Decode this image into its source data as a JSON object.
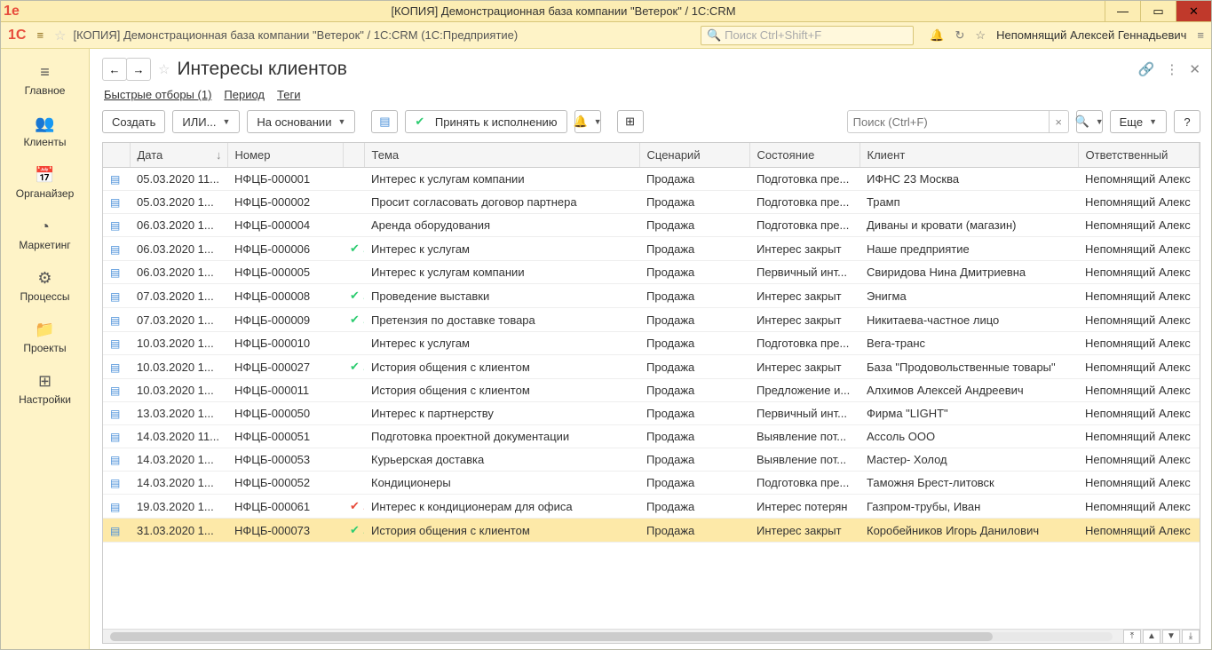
{
  "window": {
    "title": "[КОПИЯ] Демонстрационная база компании \"Ветерок\" / 1C:CRM"
  },
  "app": {
    "title": "[КОПИЯ] Демонстрационная база компании \"Ветерок\" / 1C:CRM  (1С:Предприятие)",
    "search_placeholder": "Поиск Ctrl+Shift+F",
    "user": "Непомнящий Алексей Геннадьевич"
  },
  "sidebar": {
    "items": [
      {
        "icon": "≡",
        "label": "Главное"
      },
      {
        "icon": "👥",
        "label": "Клиенты"
      },
      {
        "icon": "📅",
        "label": "Органайзер"
      },
      {
        "icon": "◔",
        "label": "Маркетинг"
      },
      {
        "icon": "⚙",
        "label": "Процессы"
      },
      {
        "icon": "📁",
        "label": "Проекты"
      },
      {
        "icon": "⊞",
        "label": "Настройки"
      }
    ]
  },
  "page": {
    "title": "Интересы клиентов"
  },
  "filters": {
    "quick": "Быстрые отборы (1)",
    "period": "Период",
    "tags": "Теги"
  },
  "toolbar": {
    "create": "Создать",
    "or": "ИЛИ...",
    "based_on": "На основании",
    "accept": "Принять к исполнению",
    "search_placeholder": "Поиск (Ctrl+F)",
    "more": "Еще",
    "help": "?"
  },
  "table": {
    "columns": {
      "date": "Дата",
      "number": "Номер",
      "theme": "Тема",
      "scenario": "Сценарий",
      "state": "Состояние",
      "client": "Клиент",
      "responsible": "Ответственный"
    },
    "rows": [
      {
        "date": "05.03.2020 11...",
        "number": "НФЦБ-000001",
        "status": "",
        "theme": "Интерес к услугам компании",
        "scenario": "Продажа",
        "state": "Подготовка пре...",
        "client": "ИФНС 23 Москва",
        "responsible": "Непомнящий Алекс"
      },
      {
        "date": "05.03.2020 1...",
        "number": "НФЦБ-000002",
        "status": "",
        "theme": "Просит согласовать договор партнера",
        "scenario": "Продажа",
        "state": "Подготовка пре...",
        "client": "Трамп",
        "responsible": "Непомнящий Алекс"
      },
      {
        "date": "06.03.2020 1...",
        "number": "НФЦБ-000004",
        "status": "",
        "theme": "Аренда оборудования",
        "scenario": "Продажа",
        "state": "Подготовка пре...",
        "client": "Диваны и кровати (магазин)",
        "responsible": "Непомнящий Алекс"
      },
      {
        "date": "06.03.2020 1...",
        "number": "НФЦБ-000006",
        "status": "ok",
        "theme": "Интерес к услугам",
        "scenario": "Продажа",
        "state": "Интерес закрыт",
        "client": "Наше предприятие",
        "responsible": "Непомнящий Алекс"
      },
      {
        "date": "06.03.2020 1...",
        "number": "НФЦБ-000005",
        "status": "",
        "theme": "Интерес к услугам компании",
        "scenario": "Продажа",
        "state": "Первичный инт...",
        "client": "Свиридова Нина Дмитриевна",
        "responsible": "Непомнящий Алекс"
      },
      {
        "date": "07.03.2020 1...",
        "number": "НФЦБ-000008",
        "status": "ok",
        "theme": "Проведение выставки",
        "scenario": "Продажа",
        "state": "Интерес закрыт",
        "client": "Энигма",
        "responsible": "Непомнящий Алекс"
      },
      {
        "date": "07.03.2020 1...",
        "number": "НФЦБ-000009",
        "status": "ok",
        "theme": "Претензия по доставке товара",
        "scenario": "Продажа",
        "state": "Интерес закрыт",
        "client": "Никитаева-частное лицо",
        "responsible": "Непомнящий Алекс"
      },
      {
        "date": "10.03.2020 1...",
        "number": "НФЦБ-000010",
        "status": "",
        "theme": "Интерес к услугам",
        "scenario": "Продажа",
        "state": "Подготовка пре...",
        "client": "Вега-транс",
        "responsible": "Непомнящий Алекс"
      },
      {
        "date": "10.03.2020 1...",
        "number": "НФЦБ-000027",
        "status": "ok",
        "theme": "История общения с клиентом",
        "scenario": "Продажа",
        "state": "Интерес закрыт",
        "client": "База \"Продовольственные товары\"",
        "responsible": "Непомнящий Алекс"
      },
      {
        "date": "10.03.2020 1...",
        "number": "НФЦБ-000011",
        "status": "",
        "theme": "История общения с клиентом",
        "scenario": "Продажа",
        "state": "Предложение и...",
        "client": "Алхимов Алексей Андреевич",
        "responsible": "Непомнящий Алекс"
      },
      {
        "date": "13.03.2020 1...",
        "number": "НФЦБ-000050",
        "status": "",
        "theme": "Интерес к партнерству",
        "scenario": "Продажа",
        "state": "Первичный инт...",
        "client": "Фирма \"LIGHT\"",
        "responsible": "Непомнящий Алекс"
      },
      {
        "date": "14.03.2020 11...",
        "number": "НФЦБ-000051",
        "status": "",
        "theme": "Подготовка проектной документации",
        "scenario": "Продажа",
        "state": "Выявление пот...",
        "client": "Ассоль ООО",
        "responsible": "Непомнящий Алекс"
      },
      {
        "date": "14.03.2020 1...",
        "number": "НФЦБ-000053",
        "status": "",
        "theme": "Курьерская доставка",
        "scenario": "Продажа",
        "state": "Выявление пот...",
        "client": "Мастер- Холод",
        "responsible": "Непомнящий Алекс"
      },
      {
        "date": "14.03.2020 1...",
        "number": "НФЦБ-000052",
        "status": "",
        "theme": "Кондиционеры",
        "scenario": "Продажа",
        "state": "Подготовка пре...",
        "client": "Таможня Брест-литовск",
        "responsible": "Непомнящий Алекс"
      },
      {
        "date": "19.03.2020 1...",
        "number": "НФЦБ-000061",
        "status": "fail",
        "theme": "Интерес к кондиционерам для офиса",
        "scenario": "Продажа",
        "state": "Интерес потерян",
        "client": "Газпром-трубы, Иван",
        "responsible": "Непомнящий Алекс"
      },
      {
        "date": "31.03.2020 1...",
        "number": "НФЦБ-000073",
        "status": "ok",
        "theme": "История общения с клиентом",
        "scenario": "Продажа",
        "state": "Интерес закрыт",
        "client": "Коробейников Игорь Данилович",
        "responsible": "Непомнящий Алекс",
        "selected": true
      }
    ]
  }
}
